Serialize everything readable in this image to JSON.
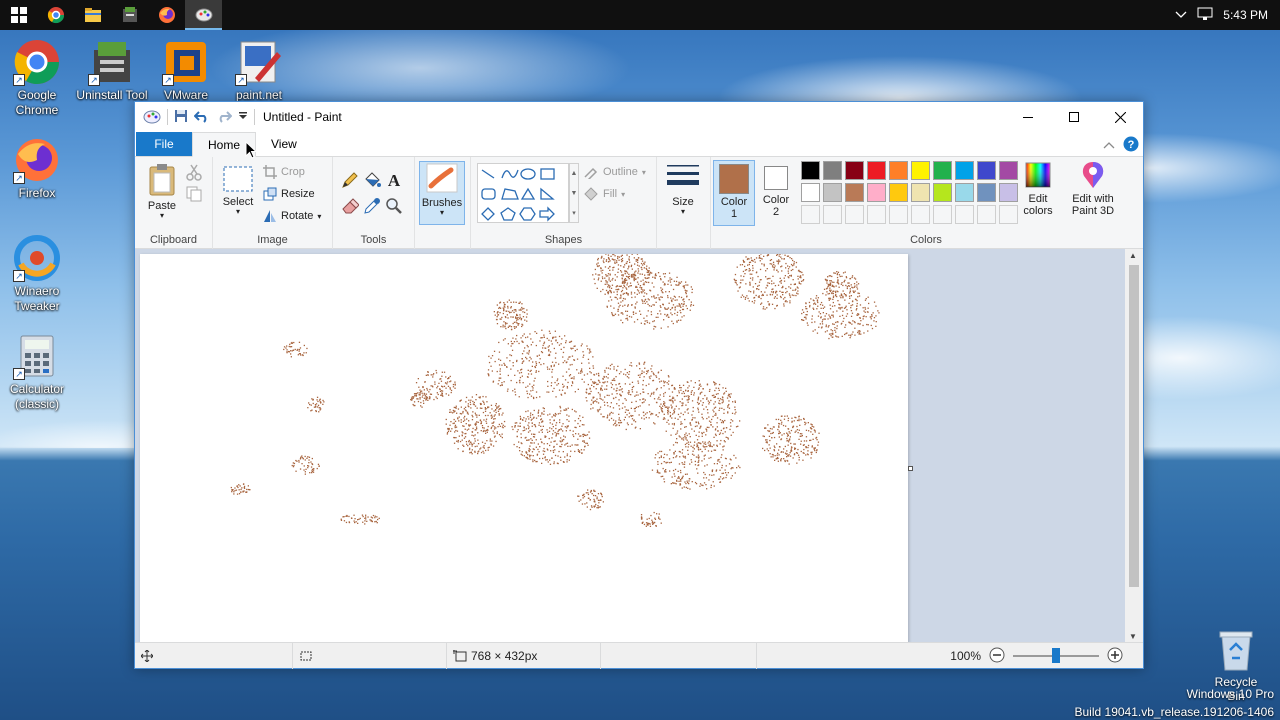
{
  "taskbar": {
    "time": "5:43 PM",
    "apps": [
      "windows-start",
      "chrome",
      "file-explorer",
      "uninstall-tool",
      "firefox",
      "paint"
    ]
  },
  "desktop": {
    "icons": [
      {
        "label": "Google Chrome"
      },
      {
        "label": "Uninstall Tool"
      },
      {
        "label": "VMware"
      },
      {
        "label": "paint.net"
      },
      {
        "label": "Firefox"
      },
      {
        "label": "Winaero Tweaker"
      },
      {
        "label": "Calculator (classic)"
      }
    ],
    "recycle_bin": "Recycle Bin",
    "watermark_line1": "Windows 10 Pro",
    "watermark_line2": "Build 19041.vb_release.191206-1406"
  },
  "window": {
    "title": "Untitled - Paint",
    "tabs": {
      "file": "File",
      "home": "Home",
      "view": "View"
    }
  },
  "ribbon": {
    "clipboard": {
      "paste": "Paste",
      "group": "Clipboard"
    },
    "image": {
      "select": "Select",
      "crop": "Crop",
      "resize": "Resize",
      "rotate": "Rotate",
      "group": "Image"
    },
    "tools": {
      "group": "Tools"
    },
    "brushes": {
      "label": "Brushes"
    },
    "shapes": {
      "outline": "Outline",
      "fill": "Fill",
      "group": "Shapes"
    },
    "size": {
      "label": "Size"
    },
    "colors": {
      "color1": "Color",
      "color1_num": "1",
      "color2": "Color",
      "color2_num": "2",
      "edit_colors_1": "Edit",
      "edit_colors_2": "colors",
      "edit_3d_1": "Edit with",
      "edit_3d_2": "Paint 3D",
      "group": "Colors",
      "color1_value": "#b0704a",
      "color2_value": "#ffffff",
      "row1": [
        "#000000",
        "#7f7f7f",
        "#880015",
        "#ed1c24",
        "#ff7f27",
        "#fff200",
        "#22b14c",
        "#00a2e8",
        "#3f48cc",
        "#a349a4"
      ],
      "row2": [
        "#ffffff",
        "#c3c3c3",
        "#b97a57",
        "#ffaec9",
        "#ffc90e",
        "#efe4b0",
        "#b5e61d",
        "#99d9ea",
        "#7092be",
        "#c8bfe7"
      ]
    }
  },
  "status": {
    "canvas_size": "768 × 432px",
    "zoom": "100%",
    "zoom_level": 1.0
  },
  "brush_color": "#a8653f"
}
